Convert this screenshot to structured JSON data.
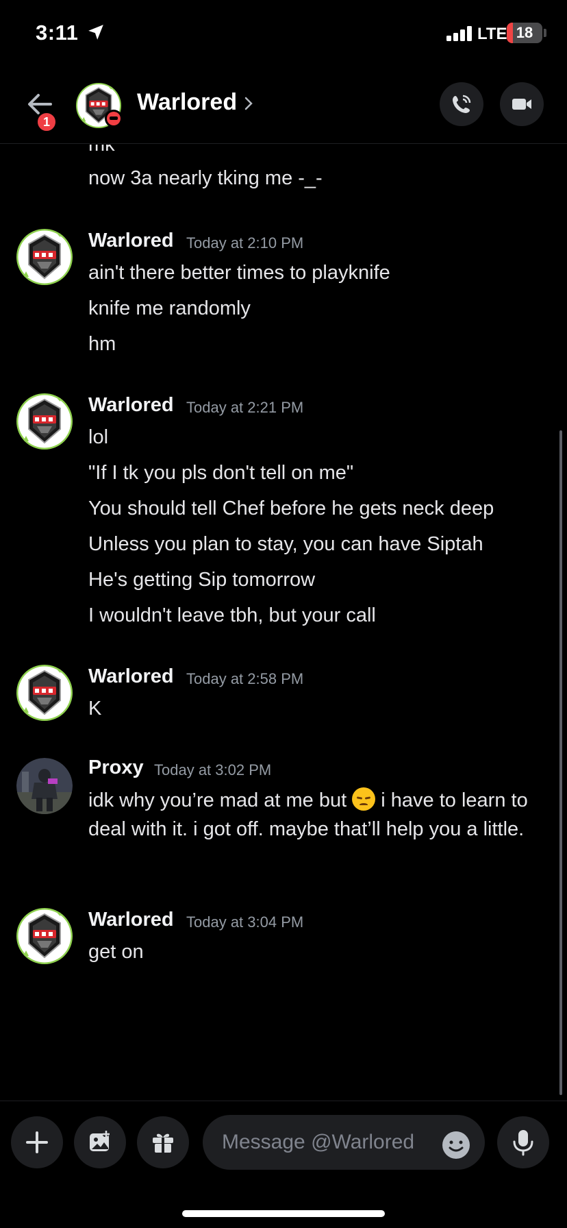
{
  "status_bar": {
    "time": "3:11",
    "network": "LTE",
    "battery": "18",
    "battery_level": 0.18,
    "icons": [
      "location-arrow-icon",
      "cellular-signal-icon",
      "battery-icon"
    ]
  },
  "header": {
    "title": "Warlored",
    "notification_count": "1",
    "status": "do-not-disturb",
    "icons": [
      "back-arrow-icon",
      "chevron-right-icon",
      "phone-call-icon",
      "video-camera-icon"
    ]
  },
  "messages": {
    "top_lines": [
      "mk",
      "now 3a nearly tking me -_-"
    ],
    "groups": [
      {
        "author": "Warlored",
        "timestamp": "Today at 2:10 PM",
        "lines": [
          "ain't there better times to playknife",
          "knife me randomly",
          "hm"
        ]
      },
      {
        "author": "Warlored",
        "timestamp": "Today at 2:21 PM",
        "lines": [
          "lol",
          "\"If I tk you pls don't tell on me\"",
          "You should tell Chef before he gets neck deep",
          "Unless you plan to stay, you can have Siptah",
          "He's getting Sip tomorrow",
          "I wouldn't leave tbh, but your call"
        ]
      },
      {
        "author": "Warlored",
        "timestamp": "Today at 2:58 PM",
        "lines": [
          "K"
        ]
      },
      {
        "author": "Proxy",
        "timestamp": "Today at 3:02 PM",
        "text_before_emoji": "idk why you’re mad at me but ",
        "emoji": "disappointed-face-emoji",
        "text_after_emoji": " i have to learn to deal with it. i got off. maybe that’ll help you a little."
      },
      {
        "author": "Warlored",
        "timestamp": "Today at 3:04 PM",
        "lines": [
          "get on"
        ]
      }
    ]
  },
  "composer": {
    "placeholder": "Message @Warlored",
    "icons": [
      "plus-icon",
      "image-icon",
      "gift-icon",
      "emoji-smile-icon",
      "microphone-icon"
    ]
  },
  "colors": {
    "background": "#000000",
    "surface": "#1e1f22",
    "text": "#e6e6e9",
    "muted": "#949ba4",
    "badge_red": "#ef3e44",
    "dnd_red": "#f23f43",
    "online_green": "#23a55a"
  }
}
